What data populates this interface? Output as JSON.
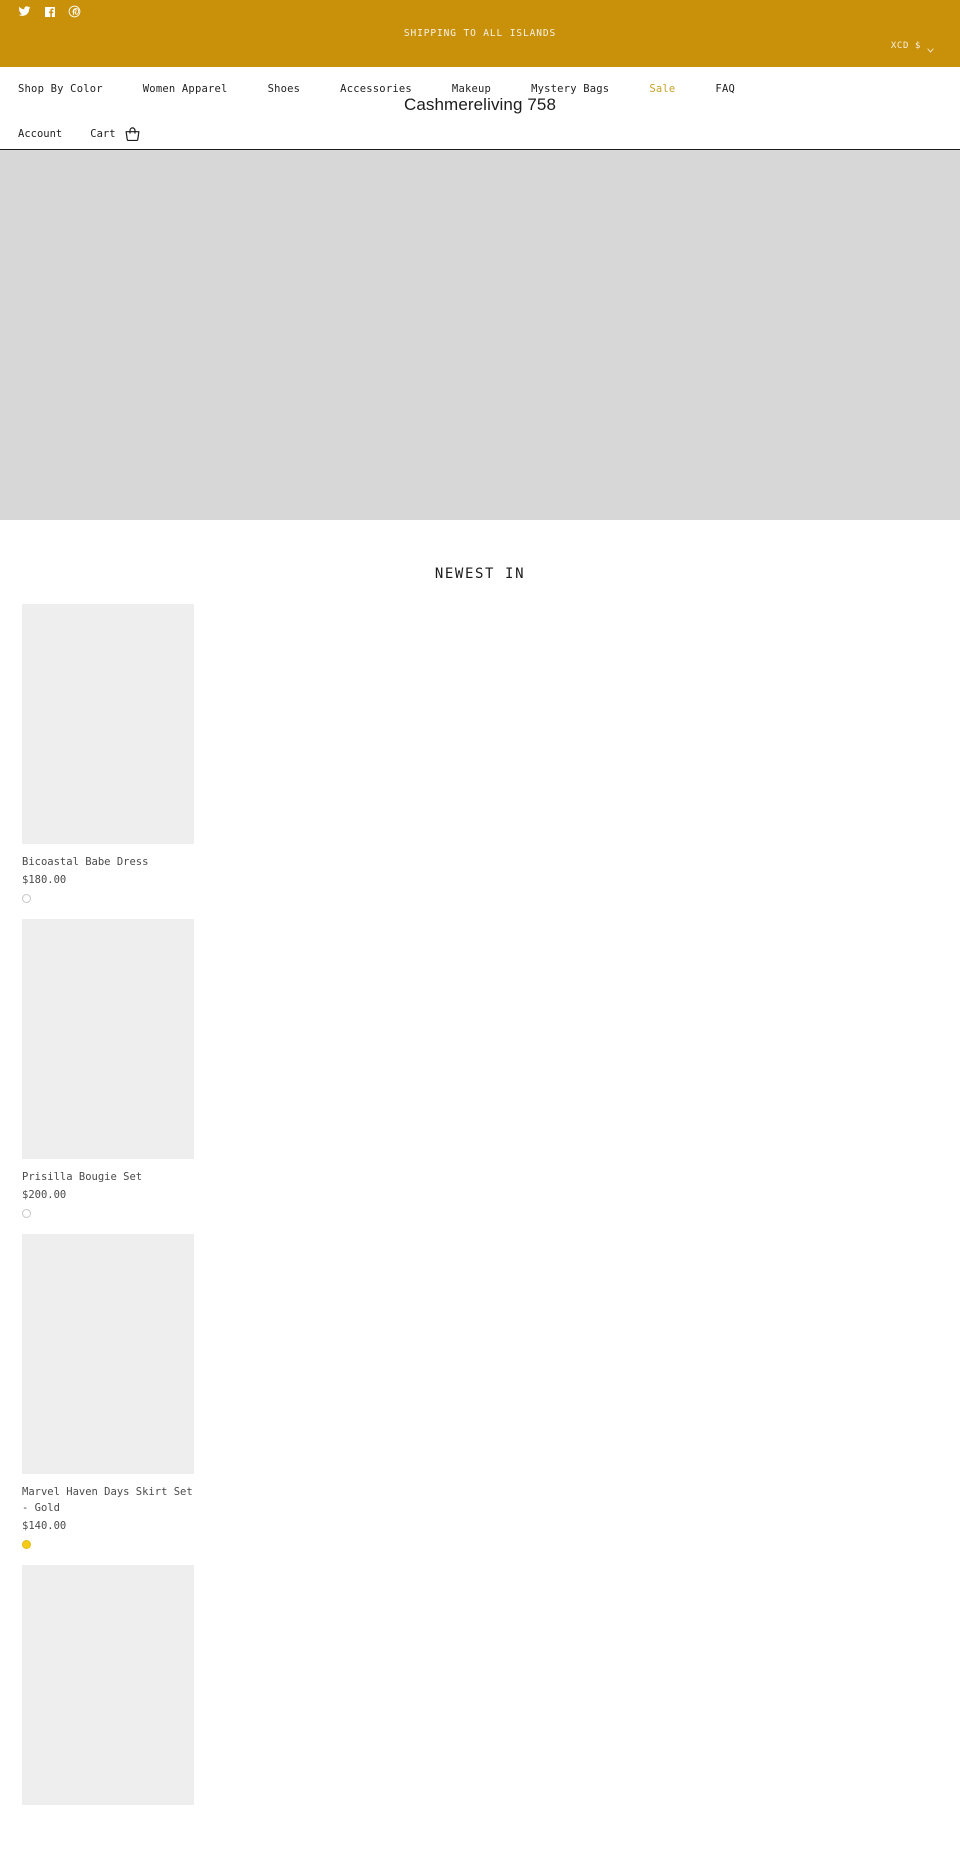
{
  "announcement": {
    "social": [
      {
        "name": "twitter-icon",
        "label": "Twitter"
      },
      {
        "name": "facebook-icon",
        "label": "Facebook"
      },
      {
        "name": "pinterest-icon",
        "label": "Pinterest"
      }
    ],
    "message": "SHIPPING TO ALL ISLANDS",
    "currency": "XCD $",
    "bar_color": "#c9910a"
  },
  "header": {
    "site_title": "Cashmereliving 758",
    "primary_nav": [
      {
        "label": "Shop By Color",
        "highlight": false
      },
      {
        "label": "Women Apparel",
        "highlight": false
      },
      {
        "label": "Shoes",
        "highlight": false
      },
      {
        "label": "Accessories",
        "highlight": false
      },
      {
        "label": "Makeup",
        "highlight": false
      },
      {
        "label": "Mystery Bags",
        "highlight": false
      },
      {
        "label": "Sale",
        "highlight": true
      },
      {
        "label": "FAQ",
        "highlight": false
      }
    ],
    "sale_color": "#c9a227",
    "secondary_nav": {
      "account": "Account",
      "cart": "Cart"
    }
  },
  "main": {
    "section_title": "NEWEST IN",
    "products": [
      {
        "title": "Bicoastal Babe Dress",
        "price": "$180.00",
        "swatches": [
          {
            "color": "#ffffff",
            "style": "outline"
          }
        ]
      },
      {
        "title": "Prisilla Bougie Set",
        "price": "$200.00",
        "swatches": [
          {
            "color": "#ffffff",
            "style": "outline"
          }
        ]
      },
      {
        "title": "Marvel Haven Days Skirt Set - Gold",
        "price": "$140.00",
        "swatches": [
          {
            "color": "#f5cb16",
            "style": "solid"
          }
        ]
      },
      {
        "title": "",
        "price": "",
        "swatches": []
      }
    ]
  }
}
